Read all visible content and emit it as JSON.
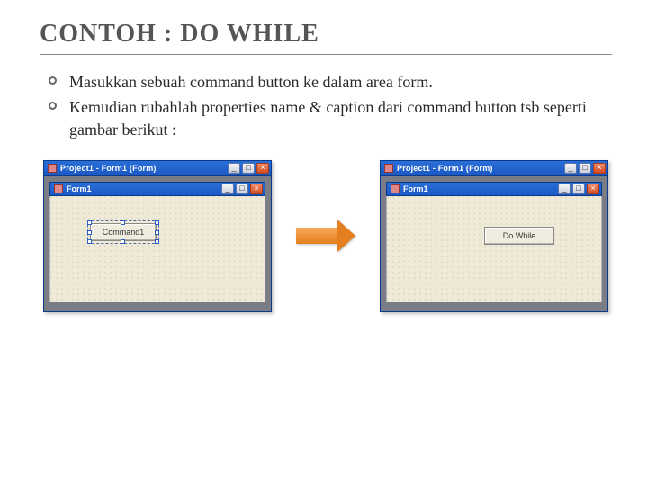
{
  "title": "CONTOH : DO WHILE",
  "bullets": [
    "Masukkan sebuah command button ke dalam area form.",
    "Kemudian rubahlah properties name & caption dari command button tsb seperti gambar berikut :"
  ],
  "vbLeft": {
    "outerTitle": "Project1 - Form1 (Form)",
    "innerTitle": "Form1",
    "buttonLabel": "Command1"
  },
  "vbRight": {
    "outerTitle": "Project1 - Form1 (Form)",
    "innerTitle": "Form1",
    "buttonLabel": "Do While"
  },
  "winGlyphs": {
    "min": "_",
    "max": "□",
    "close": "×"
  }
}
